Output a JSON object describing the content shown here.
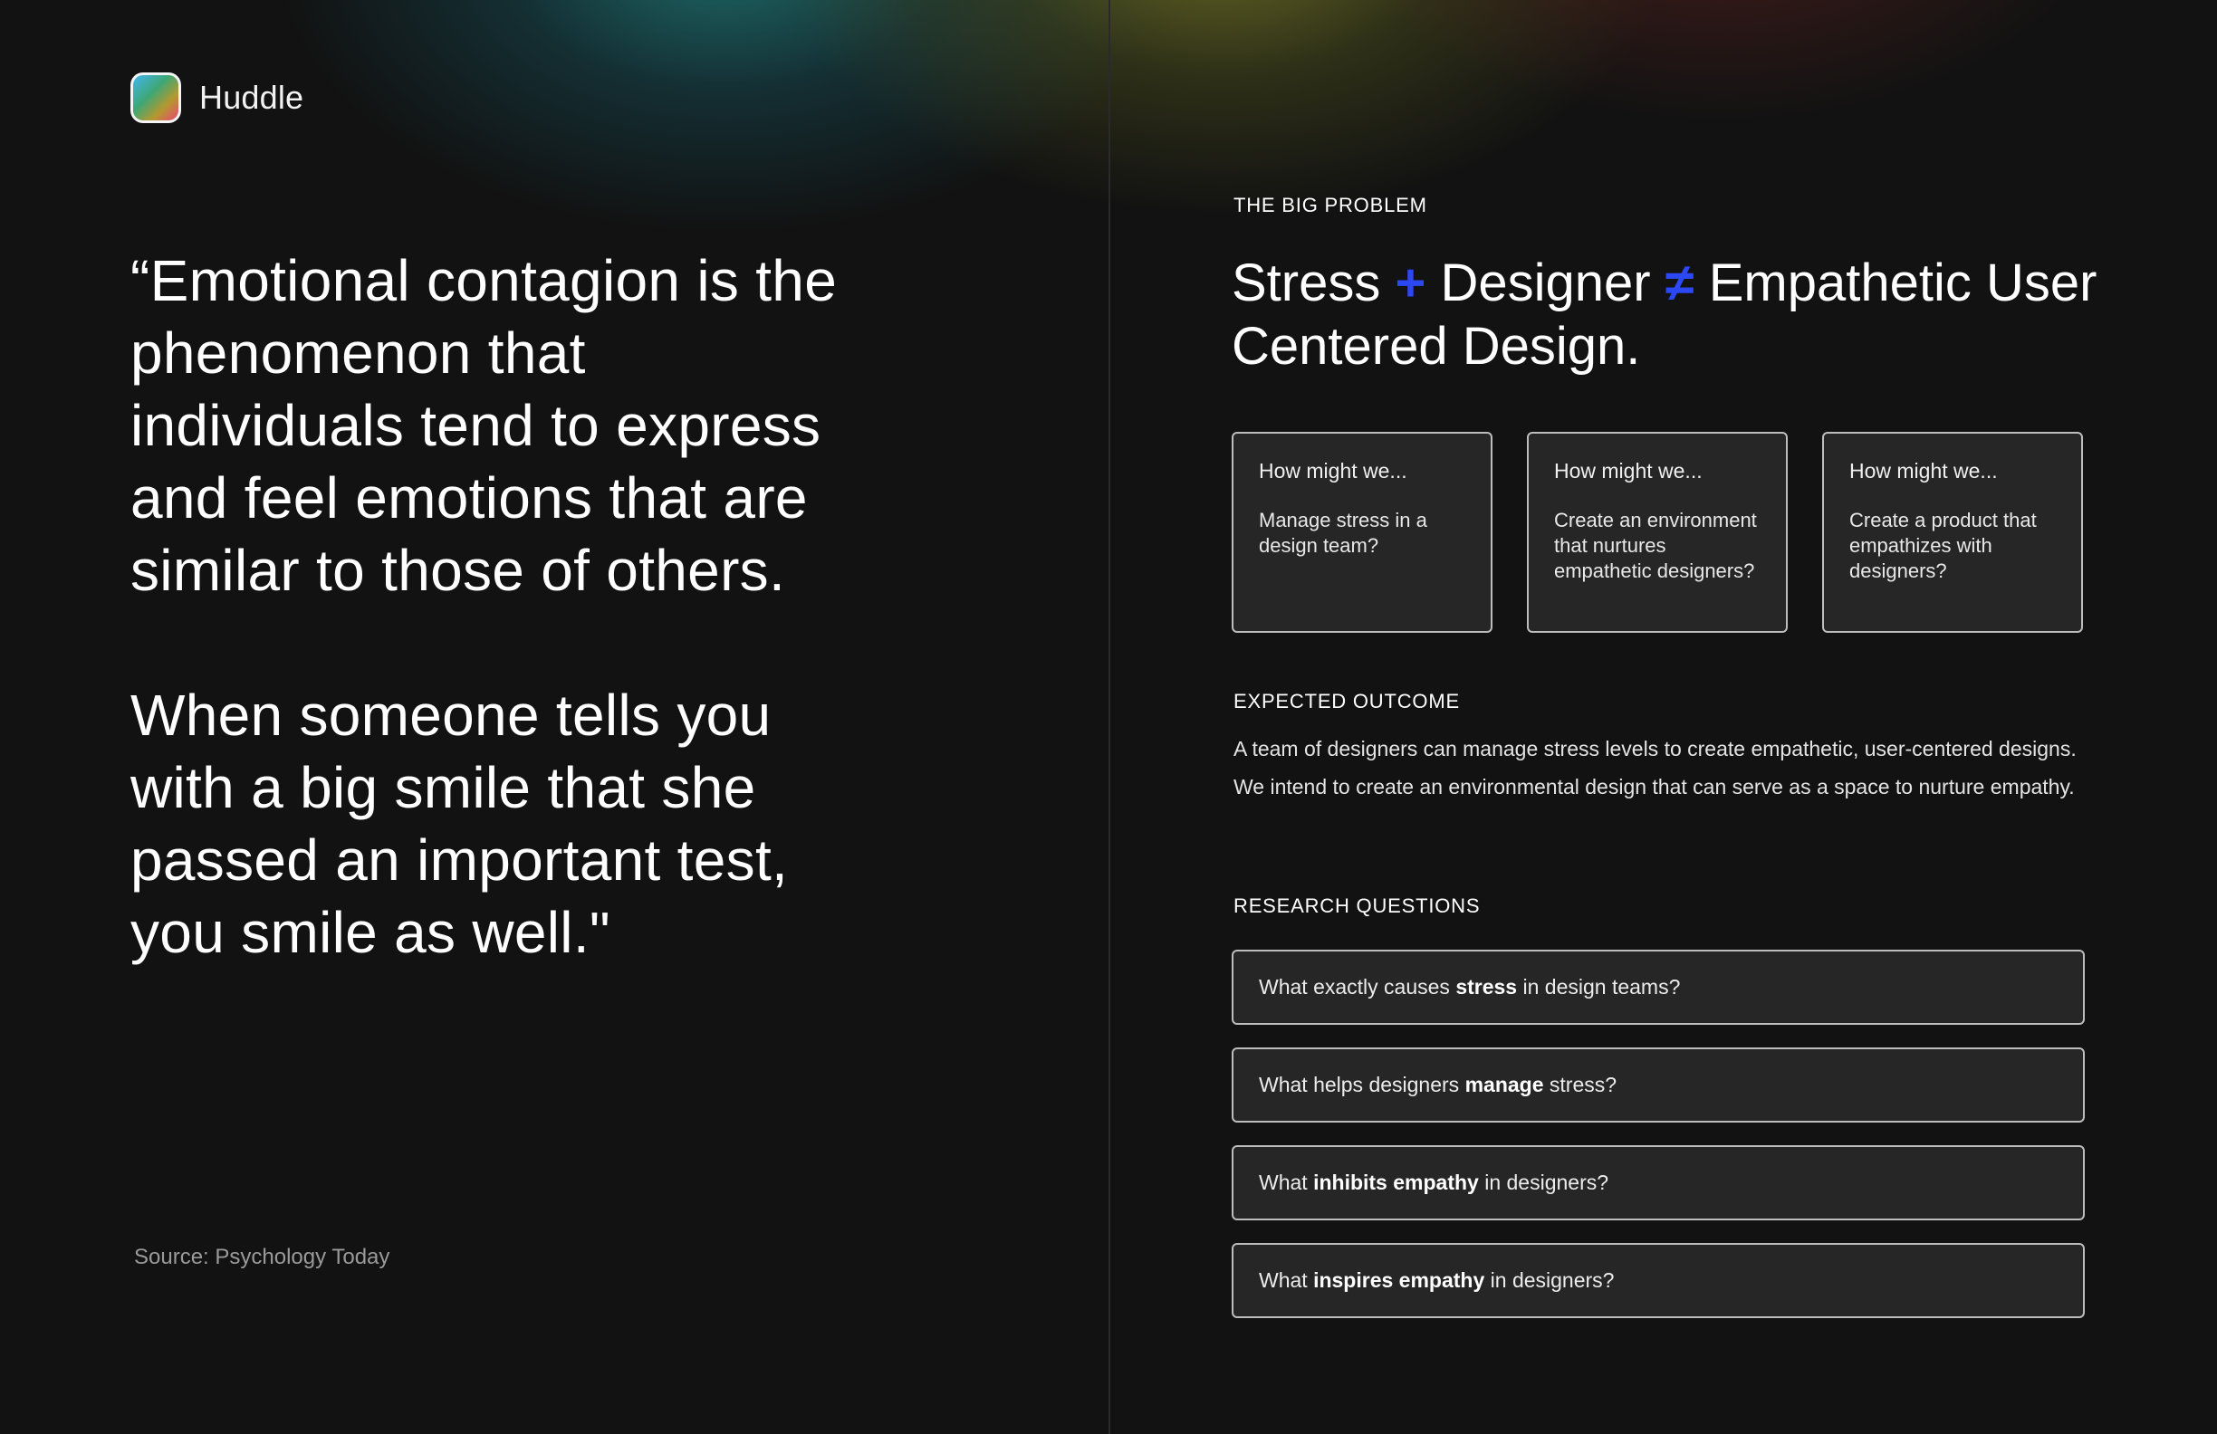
{
  "brand": {
    "name": "Huddle",
    "icon": "gradient-square-icon"
  },
  "quote": {
    "paragraph_1": "“Emotional contagion is the phenomenon that individuals tend to express and feel emotions that are similar to those of others.",
    "paragraph_2": "When someone tells you with a big smile that she passed an important test, you smile as well.\""
  },
  "source": "Source: Psychology Today",
  "problem": {
    "label": "THE BIG PROBLEM",
    "title": {
      "part1": "Stress",
      "op1": "+",
      "part2": "Designer",
      "op2": "≠",
      "part3": "Empathetic User Centered Design."
    },
    "accent_color": "#2b48f2"
  },
  "hmw_cards": [
    {
      "head": "How might we...",
      "body": "Manage stress in a design team?"
    },
    {
      "head": "How might we...",
      "body": "Create an environment that nurtures empathetic designers?"
    },
    {
      "head": "How might we...",
      "body": "Create a product that empathizes with designers?"
    }
  ],
  "outcome": {
    "label": "EXPECTED OUTCOME",
    "text": "A team of designers can manage stress levels to create empathetic, user-centered designs. We intend to create an environmental design that can serve as a space to nurture empathy."
  },
  "research": {
    "label": "RESEARCH QUESTIONS",
    "questions": [
      {
        "pre": "What exactly causes ",
        "bold": "stress",
        "post": " in design teams?"
      },
      {
        "pre": "What helps designers ",
        "bold": "manage",
        "post": " stress?"
      },
      {
        "pre": "What ",
        "bold": "inhibits empathy",
        "post": " in designers?"
      },
      {
        "pre": "What ",
        "bold": "inspires empathy",
        "post": " in designers?"
      }
    ]
  }
}
